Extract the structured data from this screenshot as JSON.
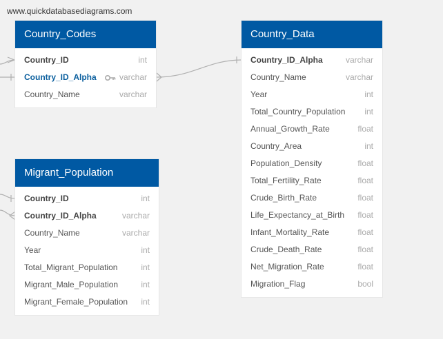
{
  "watermark": "www.quickdatabasediagrams.com",
  "tables": {
    "country_codes": {
      "title": "Country_Codes",
      "fields": [
        {
          "name": "Country_ID",
          "type": "int"
        },
        {
          "name": "Country_ID_Alpha",
          "type": "varchar"
        },
        {
          "name": "Country_Name",
          "type": "varchar"
        }
      ]
    },
    "migrant_population": {
      "title": "Migrant_Population",
      "fields": [
        {
          "name": "Country_ID",
          "type": "int"
        },
        {
          "name": "Country_ID_Alpha",
          "type": "varchar"
        },
        {
          "name": "Country_Name",
          "type": "varchar"
        },
        {
          "name": "Year",
          "type": "int"
        },
        {
          "name": "Total_Migrant_Population",
          "type": "int"
        },
        {
          "name": "Migrant_Male_Population",
          "type": "int"
        },
        {
          "name": "Migrant_Female_Population",
          "type": "int"
        }
      ]
    },
    "country_data": {
      "title": "Country_Data",
      "fields": [
        {
          "name": "Country_ID_Alpha",
          "type": "varchar"
        },
        {
          "name": "Country_Name",
          "type": "varchar"
        },
        {
          "name": "Year",
          "type": "int"
        },
        {
          "name": "Total_Country_Population",
          "type": "int"
        },
        {
          "name": "Annual_Growth_Rate",
          "type": "float"
        },
        {
          "name": "Country_Area",
          "type": "int"
        },
        {
          "name": "Population_Density",
          "type": "float"
        },
        {
          "name": "Total_Fertility_Rate",
          "type": "float"
        },
        {
          "name": "Crude_Birth_Rate",
          "type": "float"
        },
        {
          "name": "Life_Expectancy_at_Birth",
          "type": "float"
        },
        {
          "name": "Infant_Mortality_Rate",
          "type": "float"
        },
        {
          "name": "Crude_Death_Rate",
          "type": "float"
        },
        {
          "name": "Net_Migration_Rate",
          "type": "float"
        },
        {
          "name": "Migration_Flag",
          "type": "bool"
        }
      ]
    }
  }
}
